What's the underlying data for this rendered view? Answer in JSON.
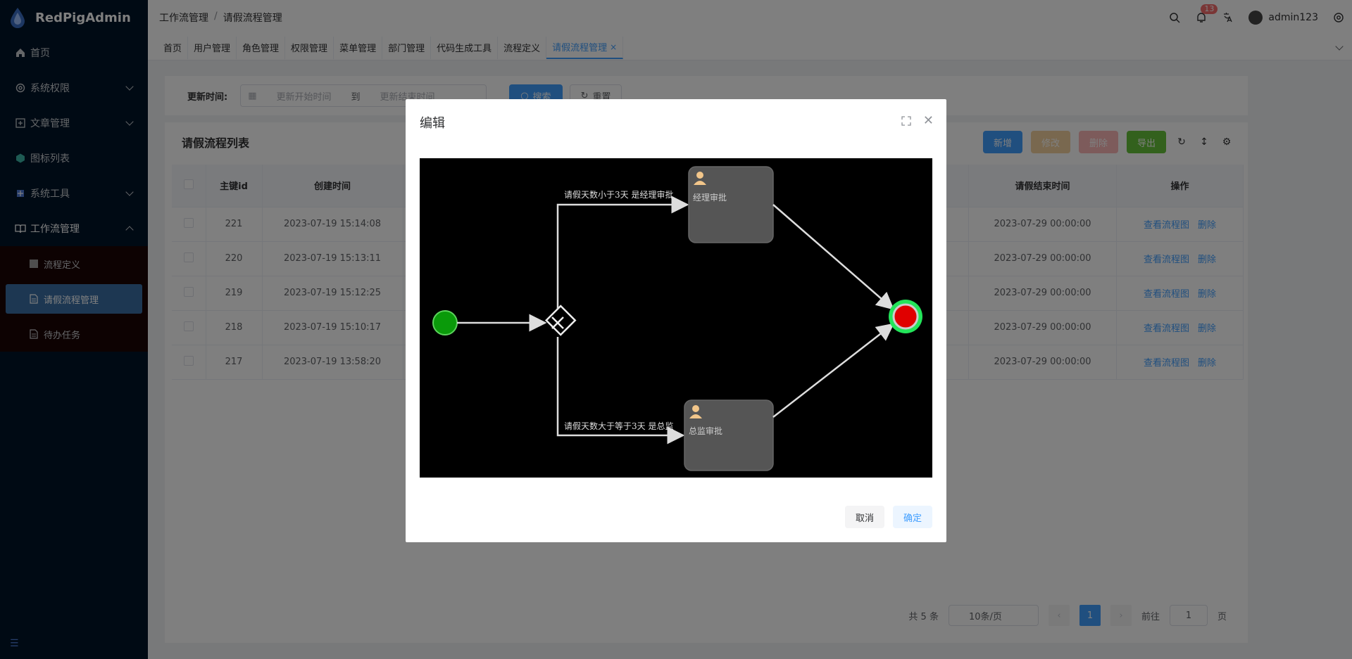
{
  "app": {
    "name": "RedPigAdmin"
  },
  "sidebar": {
    "items": [
      {
        "label": "首页"
      },
      {
        "label": "系统权限"
      },
      {
        "label": "文章管理"
      },
      {
        "label": "图标列表"
      },
      {
        "label": "系统工具"
      },
      {
        "label": "工作流管理"
      }
    ],
    "sub_items": [
      {
        "label": "流程定义"
      },
      {
        "label": "请假流程管理"
      },
      {
        "label": "待办任务"
      }
    ]
  },
  "header": {
    "breadcrumb": [
      "工作流管理",
      "请假流程管理"
    ],
    "separator": "/",
    "notify_count": "13",
    "username": "admin123"
  },
  "tags": [
    "首页",
    "用户管理",
    "角色管理",
    "权限管理",
    "菜单管理",
    "部门管理",
    "代码生成工具",
    "流程定义",
    "请假流程管理"
  ],
  "search": {
    "label": "更新时间:",
    "start_placeholder": "更新开始时间",
    "to": "到",
    "end_placeholder": "更新结束时间",
    "search_btn": "搜索",
    "reset_btn": "重置"
  },
  "list": {
    "title": "请假流程列表",
    "toolbar": {
      "add": "新增",
      "edit": "修改",
      "delete": "删除",
      "export": "导出"
    },
    "columns": [
      "主键id",
      "创建时间",
      "请假结束时间",
      "操作"
    ],
    "rows": [
      {
        "id": "221",
        "created": "2023-07-19 15:14:08",
        "end": "2023-07-29 00:00:00"
      },
      {
        "id": "220",
        "created": "2023-07-19 15:13:11",
        "end": "2023-07-29 00:00:00"
      },
      {
        "id": "219",
        "created": "2023-07-19 15:12:25",
        "end": "2023-07-29 00:00:00"
      },
      {
        "id": "218",
        "created": "2023-07-19 15:10:17",
        "end": "2023-07-29 00:00:00"
      },
      {
        "id": "217",
        "created": "2023-07-19 13:58:20",
        "end": "2023-07-29 00:00:00"
      }
    ],
    "op_view": "查看流程图",
    "op_delete": "删除"
  },
  "pager": {
    "total": "共 5 条",
    "page_size": "10条/页",
    "current": "1",
    "goto_prefix": "前往",
    "goto_value": "1",
    "goto_suffix": "页"
  },
  "dialog": {
    "title": "编辑",
    "cancel": "取消",
    "confirm": "确定",
    "flow": {
      "edge_top_label": "请假天数小于3天 是经理审批",
      "edge_bottom_label": "请假天数大于等于3天 是总监",
      "task_manager": "经理审批",
      "task_director": "总监审批"
    }
  },
  "colors": {
    "primary": "#409eff",
    "sidebar_bg": "#001529",
    "start_event": "#0a9a0a",
    "end_event": "#e00000",
    "end_glow": "#23e55a"
  }
}
